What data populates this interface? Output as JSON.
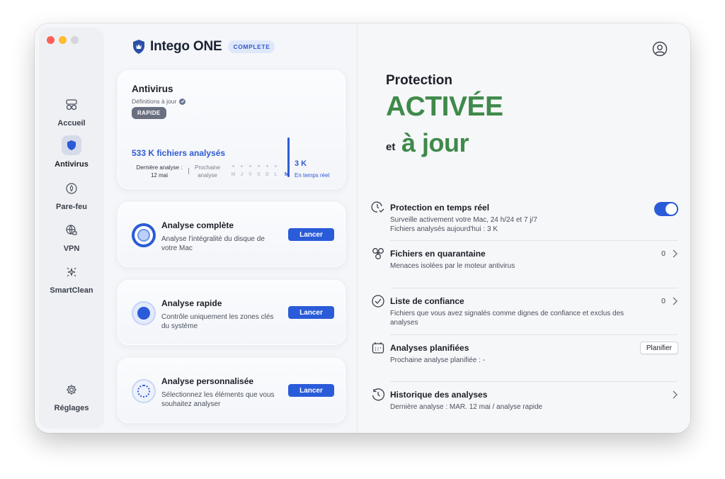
{
  "sidebar": {
    "items": [
      {
        "label": "Accueil",
        "icon": "home-grid-icon"
      },
      {
        "label": "Antivirus",
        "icon": "shield-icon"
      },
      {
        "label": "Pare-feu",
        "icon": "firewall-icon"
      },
      {
        "label": "VPN",
        "icon": "vpn-globe-icon"
      },
      {
        "label": "SmartClean",
        "icon": "sparkle-icon"
      },
      {
        "label": "Réglages",
        "icon": "gear-icon"
      }
    ]
  },
  "brand": {
    "name": "Intego ONE",
    "badge": "COMPLETE"
  },
  "antivirus": {
    "title": "Antivirus",
    "subtitle": "Définitions à jour",
    "tag": "RAPIDE",
    "files_scanned": "533 K fichiers analysés",
    "last_scan_label": "Dernière analyse :",
    "last_scan_date": "12 mai",
    "next_scan_label": "Prochaine",
    "next_scan_label2": "analyse",
    "days": [
      "M",
      "J",
      "V",
      "S",
      "D",
      "L",
      "M"
    ],
    "realtime_count": "3 K",
    "realtime_label": "En temps réel"
  },
  "scans": [
    {
      "title": "Analyse complète",
      "desc": "Analyse l'intégralité du disque de votre Mac",
      "button": "Lancer"
    },
    {
      "title": "Analyse rapide",
      "desc": "Contrôle uniquement les zones clés du système",
      "button": "Lancer"
    },
    {
      "title": "Analyse personnalisée",
      "desc": "Sélectionnez les éléments que vous souhaitez analyser",
      "button": "Lancer"
    }
  ],
  "status": {
    "line1": "Protection",
    "line2": "ACTIVÉE",
    "line3a": "et",
    "line3b": "à jour"
  },
  "rows": {
    "realtime": {
      "title": "Protection en temps réel",
      "desc1": "Surveille activement votre Mac, 24 h/24 et 7 j/7",
      "desc2": "Fichiers analysés aujourd'hui :  3 K",
      "enabled": true
    },
    "quarantine": {
      "title": "Fichiers en quarantaine",
      "desc": "Menaces isolées par le moteur antivirus",
      "count": "0"
    },
    "trust": {
      "title": "Liste de confiance",
      "desc": "Fichiers que vous avez signalés comme dignes de confiance et exclus des analyses",
      "count": "0"
    },
    "scheduled": {
      "title": "Analyses planifiées",
      "desc": "Prochaine analyse planifiée :  -",
      "button": "Planifier"
    },
    "history": {
      "title": "Historique des analyses",
      "desc": "Dernière analyse :  MAR. 12 mai   /   analyse rapide"
    }
  },
  "colors": {
    "accent": "#2a5bd8",
    "success": "#3f8a4a"
  }
}
